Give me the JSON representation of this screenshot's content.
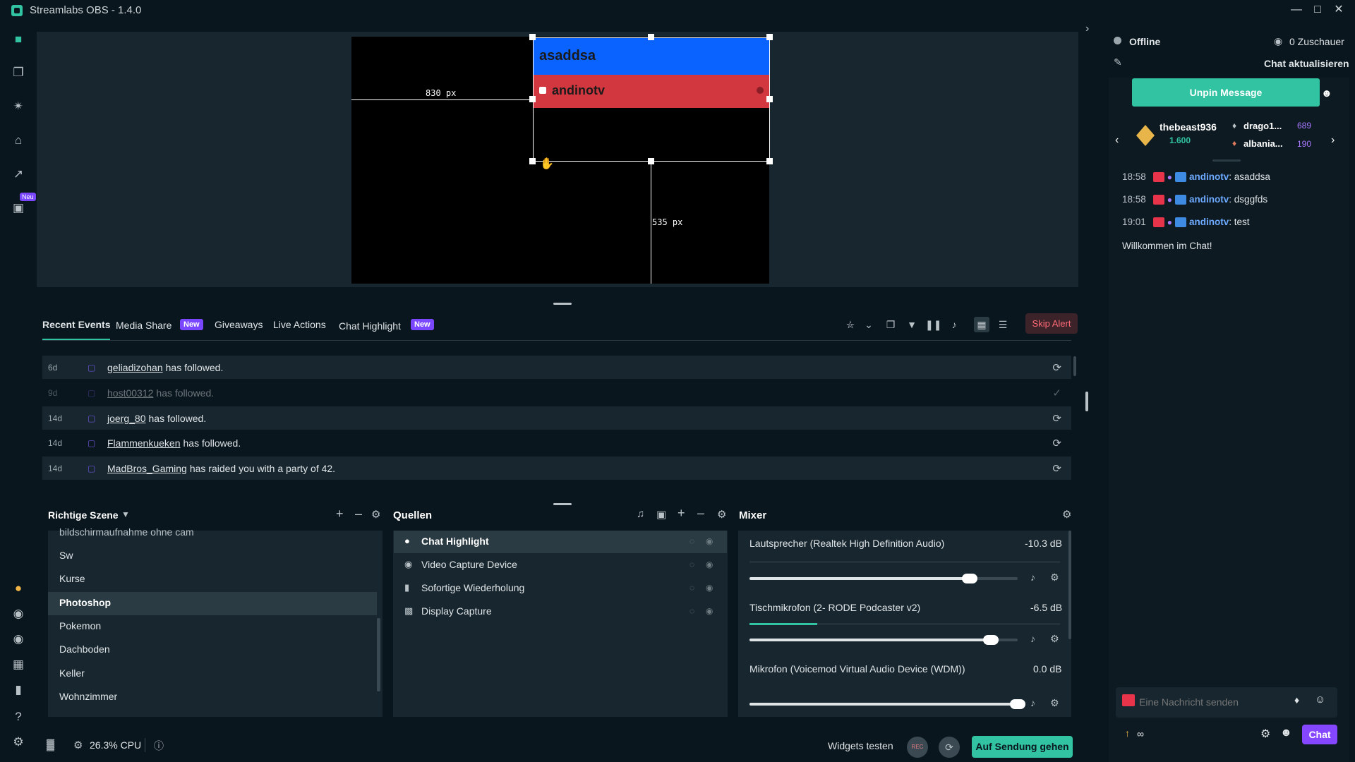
{
  "window": {
    "title": "Streamlabs OBS - 1.4.0"
  },
  "nav": {
    "new_badge": "Neu"
  },
  "preview": {
    "source_top_text": "asaddsa",
    "source_bottom_text": "andinotv",
    "guide_h_label": "830  px",
    "guide_v_label": "535  px"
  },
  "tabs": [
    {
      "label": "Recent Events"
    },
    {
      "label": "Media Share",
      "badge": "New"
    },
    {
      "label": "Giveaways"
    },
    {
      "label": "Live Actions"
    },
    {
      "label": "Chat Highlight",
      "badge": "New"
    }
  ],
  "skip_alert": "Skip Alert",
  "events": [
    {
      "time": "6d",
      "name": "geliadizohan",
      "text": "has followed."
    },
    {
      "time": "9d",
      "name": "host00312",
      "text": "has followed."
    },
    {
      "time": "14d",
      "name": "joerg_80",
      "text": "has followed."
    },
    {
      "time": "14d",
      "name": "Flammenkueken",
      "text": "has followed."
    },
    {
      "time": "14d",
      "name": "MadBros_Gaming",
      "text": "has raided you with a party of 42."
    }
  ],
  "scenes": {
    "title": "Richtige Szene",
    "items": [
      "bildschirmaufnahme ohne cam",
      "Sw",
      "Kurse",
      "Photoshop",
      "Pokemon",
      "Dachboden",
      "Keller",
      "Wohnzimmer"
    ]
  },
  "sources": {
    "title": "Quellen",
    "items": [
      "Chat Highlight",
      "Video Capture Device",
      "Sofortige Wiederholung",
      "Display Capture"
    ]
  },
  "mixer": {
    "title": "Mixer",
    "channels": [
      {
        "name": "Lautsprecher (Realtek High Definition Audio)",
        "db": "-10.3 dB",
        "level": 0.82
      },
      {
        "name": "Tischmikrofon (2- RODE Podcaster v2)",
        "db": "-6.5 dB",
        "level": 0.9
      },
      {
        "name": "Mikrofon (Voicemod Virtual Audio Device (WDM))",
        "db": "0.0 dB",
        "level": 1.0
      }
    ]
  },
  "status": {
    "cpu": "26.3% CPU",
    "widgets_test": "Widgets testen",
    "rec": "REC",
    "go_live": "Auf Sendung gehen"
  },
  "chat": {
    "status": "Offline",
    "viewers": "0 Zuschauer",
    "refresh": "Chat aktualisieren",
    "unpin": "Unpin Message",
    "top_user": {
      "name": "thebeast936",
      "amount": "1.600"
    },
    "side_users": [
      {
        "name": "drago1...",
        "amount": "689"
      },
      {
        "name": "albania...",
        "amount": "190"
      }
    ],
    "messages": [
      {
        "time": "18:58",
        "user": "andinotv",
        "text": ": asaddsa"
      },
      {
        "time": "18:58",
        "user": "andinotv",
        "text": ": dsggfds"
      },
      {
        "time": "19:01",
        "user": "andinotv",
        "text": ": test"
      }
    ],
    "welcome": "Willkommen im Chat!",
    "input_placeholder": "Eine Nachricht senden",
    "infinity": "∞",
    "send": "Chat"
  },
  "colors": {
    "accent": "#31c3a2",
    "new_badge": "#7a47ff",
    "chat_user": "#6da9ff"
  }
}
